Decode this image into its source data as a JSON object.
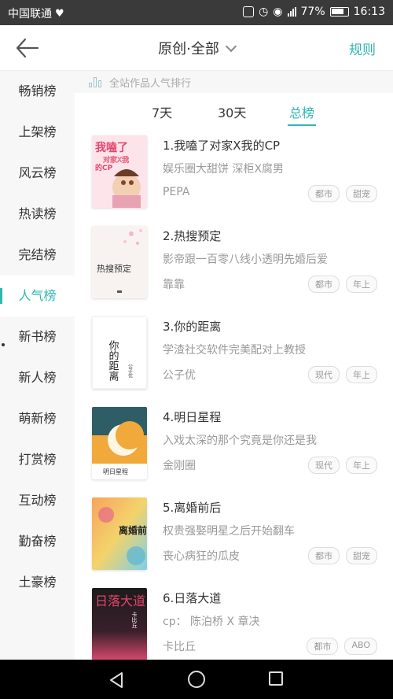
{
  "statusbar": {
    "carrier": "中国联通",
    "battery": "77%",
    "time": "16:13"
  },
  "header": {
    "title": "原创·全部",
    "rules_label": "规则"
  },
  "sidebar": {
    "items": [
      {
        "label": "畅销榜"
      },
      {
        "label": "上架榜"
      },
      {
        "label": "风云榜"
      },
      {
        "label": "热读榜"
      },
      {
        "label": "完结榜"
      },
      {
        "label": "人气榜"
      },
      {
        "label": "新书榜"
      },
      {
        "label": "新人榜"
      },
      {
        "label": "萌新榜"
      },
      {
        "label": "打赏榜"
      },
      {
        "label": "互动榜"
      },
      {
        "label": "勤奋榜"
      },
      {
        "label": "土豪榜"
      }
    ],
    "active_index": 5
  },
  "main": {
    "banner": "全站作品人气排行",
    "tabs": [
      {
        "label": "7天"
      },
      {
        "label": "30天"
      },
      {
        "label": "总榜"
      }
    ],
    "active_tab": 2,
    "books": [
      {
        "title": "1.我嗑了对家X我的CP",
        "desc": "娱乐圈大甜饼 深柜X腐男",
        "author": "PEPA",
        "tags": [
          "都市",
          "甜宠"
        ],
        "cover_text": "我嗑了",
        "cover_sub": "对家X我",
        "cover_sub2": "的CP"
      },
      {
        "title": "2.热搜预定",
        "desc": "影帝跟一百零八线小透明先婚后爱",
        "author": "靠靠",
        "tags": [
          "都市",
          "年上"
        ],
        "cover_text": "热搜预定"
      },
      {
        "title": "3.你的距离",
        "desc": "学渣社交软件完美配对上教授",
        "author": "公子优",
        "tags": [
          "现代",
          "年上"
        ],
        "cover_text": "你的距离",
        "cover_sub": "公子优"
      },
      {
        "title": "4.明日星程",
        "desc": "入戏太深的那个究竟是你还是我",
        "author": "金刚圈",
        "tags": [
          "现代",
          "年上"
        ],
        "cover_text": "明日星程"
      },
      {
        "title": "5.离婚前后",
        "desc": "权贵强娶明星之后开始翻车",
        "author": "丧心病狂的瓜皮",
        "tags": [
          "都市",
          "甜宠"
        ],
        "cover_text": "离婚前后"
      },
      {
        "title": "6.日落大道",
        "desc": "cp： 陈泊桥 X 章决",
        "author": "卡比丘",
        "tags": [
          "都市",
          "ABO"
        ],
        "cover_text": "日落大道",
        "cover_sub": "卡比丘"
      }
    ]
  },
  "colors": {
    "accent": "#2fb8b0",
    "statusbar": "#3a3a3a",
    "sidebar_bg": "#f7f7f7"
  }
}
